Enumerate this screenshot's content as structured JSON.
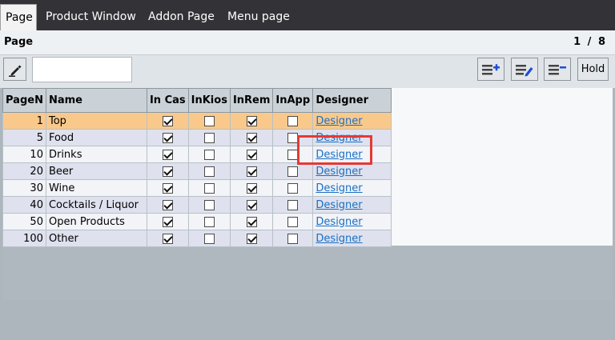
{
  "tabs": [
    "Page",
    "Product Window",
    "Addon Page",
    "Menu page"
  ],
  "panel": {
    "title": "Page",
    "pager": {
      "current": "1",
      "separator": "/",
      "total": "8"
    }
  },
  "toolbar": {
    "search_value": "",
    "hold_label": "Hold"
  },
  "grid": {
    "columns": [
      "PageN",
      "Name",
      "In Cas",
      "InKios",
      "InRem",
      "InApp",
      "Designer"
    ],
    "rows": [
      {
        "num": "1",
        "name": "Top",
        "in_cash": true,
        "in_kiosk": false,
        "in_remote": true,
        "in_app": false,
        "designer": "Designer"
      },
      {
        "num": "5",
        "name": "Food",
        "in_cash": true,
        "in_kiosk": false,
        "in_remote": true,
        "in_app": false,
        "designer": "Designer"
      },
      {
        "num": "10",
        "name": "Drinks",
        "in_cash": true,
        "in_kiosk": false,
        "in_remote": true,
        "in_app": false,
        "designer": "Designer"
      },
      {
        "num": "20",
        "name": "Beer",
        "in_cash": true,
        "in_kiosk": false,
        "in_remote": true,
        "in_app": false,
        "designer": "Designer"
      },
      {
        "num": "30",
        "name": "Wine",
        "in_cash": true,
        "in_kiosk": false,
        "in_remote": true,
        "in_app": false,
        "designer": "Designer"
      },
      {
        "num": "40",
        "name": "Cocktails / Liquor",
        "in_cash": true,
        "in_kiosk": false,
        "in_remote": true,
        "in_app": false,
        "designer": "Designer"
      },
      {
        "num": "50",
        "name": "Open Products",
        "in_cash": true,
        "in_kiosk": false,
        "in_remote": true,
        "in_app": false,
        "designer": "Designer"
      },
      {
        "num": "100",
        "name": "Other",
        "in_cash": true,
        "in_kiosk": false,
        "in_remote": true,
        "in_app": false,
        "designer": "Designer"
      }
    ]
  },
  "colors": {
    "selected_row": "#f9c98c",
    "link": "#1a6fc4",
    "highlight_box": "#e53935"
  }
}
